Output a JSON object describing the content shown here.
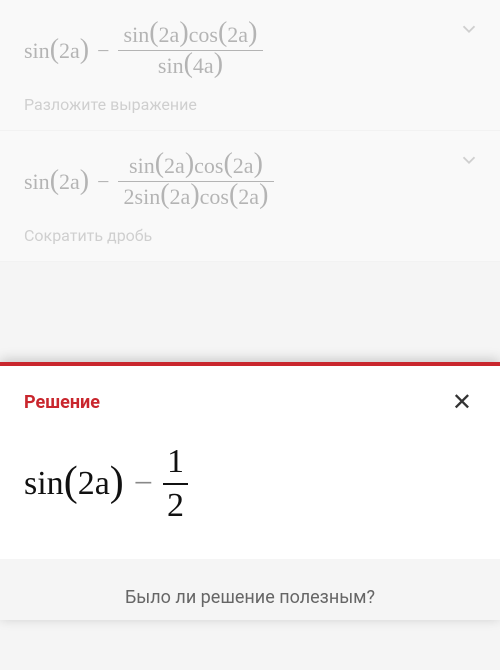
{
  "steps": [
    {
      "left": "sin",
      "left_arg": "2a",
      "num": "sin(2a)cos(2a)",
      "den": "sin(4a)",
      "hint": "Разложите выражение"
    },
    {
      "left": "sin",
      "left_arg": "2a",
      "num": "sin(2a)cos(2a)",
      "den": "2sin(2a)cos(2a)",
      "hint": "Сократить дробь"
    }
  ],
  "solution": {
    "title": "Решение",
    "left": "sin",
    "left_arg": "2a",
    "frac_num": "1",
    "frac_den": "2"
  },
  "feedback_prompt": "Было ли решение полезным?",
  "glyphs": {
    "minus": "−"
  }
}
